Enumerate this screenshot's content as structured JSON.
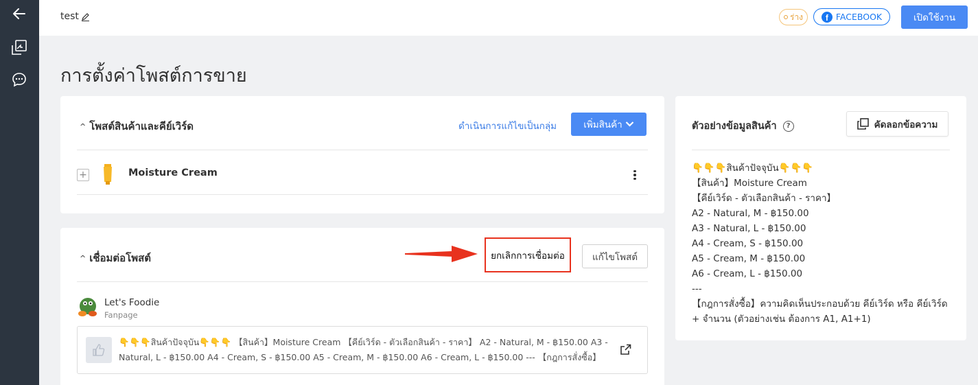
{
  "topbar": {
    "title": "test",
    "draft_badge": "ร่าง",
    "facebook_label": "FACEBOOK",
    "enable_button": "เปิดใช้งาน"
  },
  "page_title": "การตั้งค่าโพสต์การขาย",
  "products_card": {
    "title": "โพสต์สินค้าและคีย์เวิร์ด",
    "bulk_edit_link": "ดำเนินการแก้ไขเป็นกลุ่ม",
    "add_product_button": "เพิ่มสินค้า",
    "items": [
      {
        "name": "Moisture Cream"
      }
    ]
  },
  "link_card": {
    "title": "เชื่อมต่อโพสต์",
    "unlink_button": "ยกเลิกการเชื่อมต่อ",
    "edit_post_button": "แก้ไขโพสต์",
    "page": {
      "name": "Let's Foodie",
      "type": "Fanpage"
    },
    "post_text": "👇👇👇สินค้าปัจจุบัน👇👇👇 【สินค้า】Moisture Cream 【คีย์เวิร์ด - ตัวเลือกสินค้า - ราคา】 A2 - Natural, M - ฿150.00 A3 - Natural, L - ฿150.00 A4 - Cream, S - ฿150.00 A5 - Cream, M - ฿150.00 A6 - Cream, L - ฿150.00 --- 【กฎการสั่งซื้อ】ความคิ..."
  },
  "sample_card": {
    "title": "ตัวอย่างข้อมูลสินค้า",
    "copy_button": "คัดลอกข้อความ",
    "lines": [
      "👇👇👇สินค้าปัจจุบัน👇👇👇",
      "【สินค้า】Moisture Cream",
      "【คีย์เวิร์ด - ตัวเลือกสินค้า - ราคา】",
      "A2 - Natural, M - ฿150.00",
      "A3 - Natural, L - ฿150.00",
      "A4 - Cream, S - ฿150.00",
      "A5 - Cream, M - ฿150.00",
      "A6 - Cream, L - ฿150.00",
      "---",
      "【กฎการสั่งซื้อ】ความคิดเห็นประกอบด้วย คีย์เวิร์ด หรือ คีย์เวิร์ด + จำนวน (ตัวอย่างเช่น ต้องการ A1, A1+1)"
    ]
  },
  "colors": {
    "sidebar": "#2c3540",
    "primary": "#4a8af4",
    "facebook": "#1877f2",
    "highlight": "#e8321e"
  }
}
